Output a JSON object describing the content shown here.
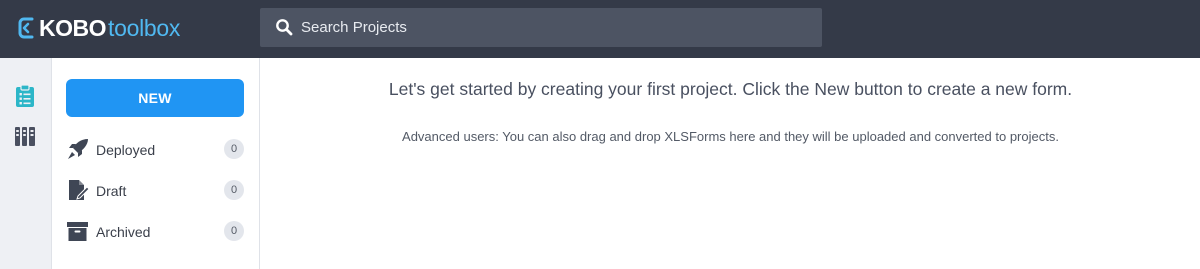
{
  "header": {
    "logo": {
      "brand_bold": "KOBO",
      "brand_light": "toolbox",
      "accent_color": "#50b8f0"
    },
    "search": {
      "placeholder": "Search Projects",
      "icon": "search-icon"
    },
    "background_color": "#343a48"
  },
  "rail": {
    "items": [
      {
        "icon": "clipboard-list-icon",
        "active": true,
        "color": "#2cb6c8"
      },
      {
        "icon": "library-books-icon",
        "active": false,
        "color": "#4a5060"
      }
    ]
  },
  "sidebar": {
    "new_button": {
      "label": "NEW",
      "color": "#2095f3"
    },
    "items": [
      {
        "label": "Deployed",
        "count": "0",
        "icon": "rocket-icon"
      },
      {
        "label": "Draft",
        "count": "0",
        "icon": "draft-document-icon"
      },
      {
        "label": "Archived",
        "count": "0",
        "icon": "archive-box-icon"
      }
    ]
  },
  "main": {
    "heading": "Let's get started by creating your first project. Click the New button to create a new form.",
    "subtext": "Advanced users: You can also drag and drop XLSForms here and they will be uploaded and converted to projects."
  }
}
